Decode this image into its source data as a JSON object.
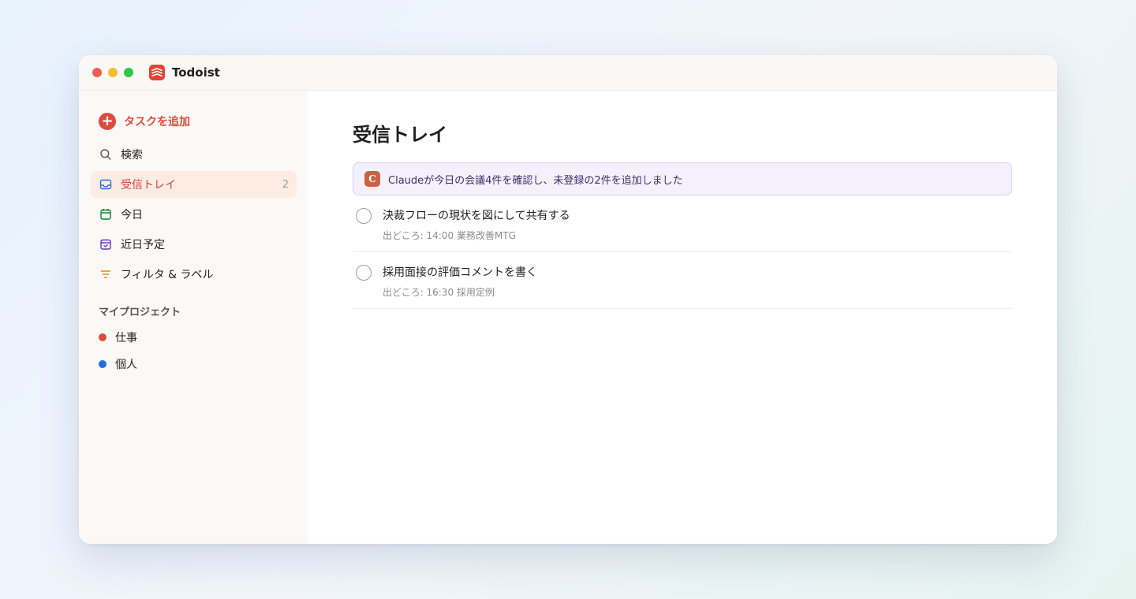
{
  "app": {
    "title": "Todoist"
  },
  "sidebar": {
    "add_task_label": "タスクを追加",
    "items": [
      {
        "label": "検索",
        "icon": "search-icon",
        "count": ""
      },
      {
        "label": "受信トレイ",
        "icon": "inbox-icon",
        "count": "2",
        "active": true,
        "color": "#d1453b"
      },
      {
        "label": "今日",
        "icon": "calendar-today-icon",
        "count": "",
        "color": "#058527"
      },
      {
        "label": "近日予定",
        "icon": "calendar-upcoming-icon",
        "count": "",
        "color": "#692fc2"
      },
      {
        "label": "フィルタ & ラベル",
        "icon": "filter-icon",
        "count": "",
        "color": "#eb8909"
      }
    ],
    "projects_header": "マイプロジェクト",
    "projects": [
      {
        "label": "仕事",
        "color": "#dc4c3e"
      },
      {
        "label": "個人",
        "color": "#246fe0"
      }
    ]
  },
  "main": {
    "title": "受信トレイ",
    "banner": {
      "badge": "C",
      "text": "Claudeが今日の会議4件を確認し、未登録の2件を追加しました"
    },
    "tasks": [
      {
        "title": "決裁フローの現状を図にして共有する",
        "meta": "出どころ: 14:00 業務改善MTG"
      },
      {
        "title": "採用面接の評価コメントを書く",
        "meta": "出どころ: 16:30 採用定例"
      }
    ]
  }
}
